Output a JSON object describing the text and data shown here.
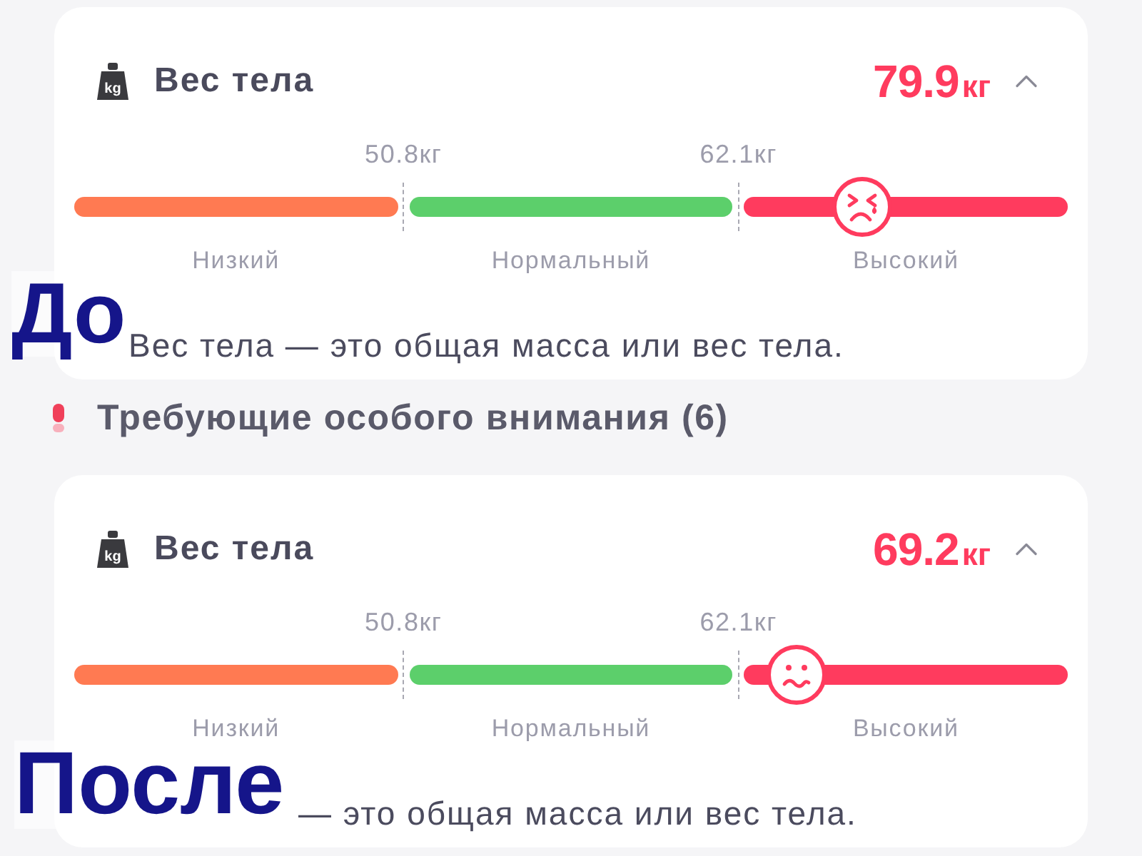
{
  "panels": [
    {
      "caption": "До",
      "card": {
        "icon_text": "kg",
        "title": "Вес тела",
        "value": "79.9",
        "unit": "кг",
        "expanded": true,
        "thresholds": [
          "50.8кг",
          "62.1кг"
        ],
        "ranges": [
          {
            "label": "Низкий",
            "color": "#ff7a52"
          },
          {
            "label": "Нормальный",
            "color": "#5ccf6b"
          },
          {
            "label": "Высокий",
            "color": "#ff3b5e"
          }
        ],
        "marker": {
          "level": 0.793,
          "kind": "distressed"
        },
        "description": "Вес тела — это общая масса или вес тела."
      },
      "section_heading": "Требующие особого внимания (6)"
    },
    {
      "caption": "После",
      "card": {
        "icon_text": "kg",
        "title": "Вес тела",
        "value": "69.2",
        "unit": "кг",
        "expanded": true,
        "thresholds": [
          "50.8кг",
          "62.1кг"
        ],
        "ranges": [
          {
            "label": "Низкий",
            "color": "#ff7a52"
          },
          {
            "label": "Нормальный",
            "color": "#5ccf6b"
          },
          {
            "label": "Высокий",
            "color": "#ff3b5e"
          }
        ],
        "marker": {
          "level": 0.727,
          "kind": "uneasy"
        },
        "description": "— это общая масса или вес тела."
      }
    }
  ]
}
